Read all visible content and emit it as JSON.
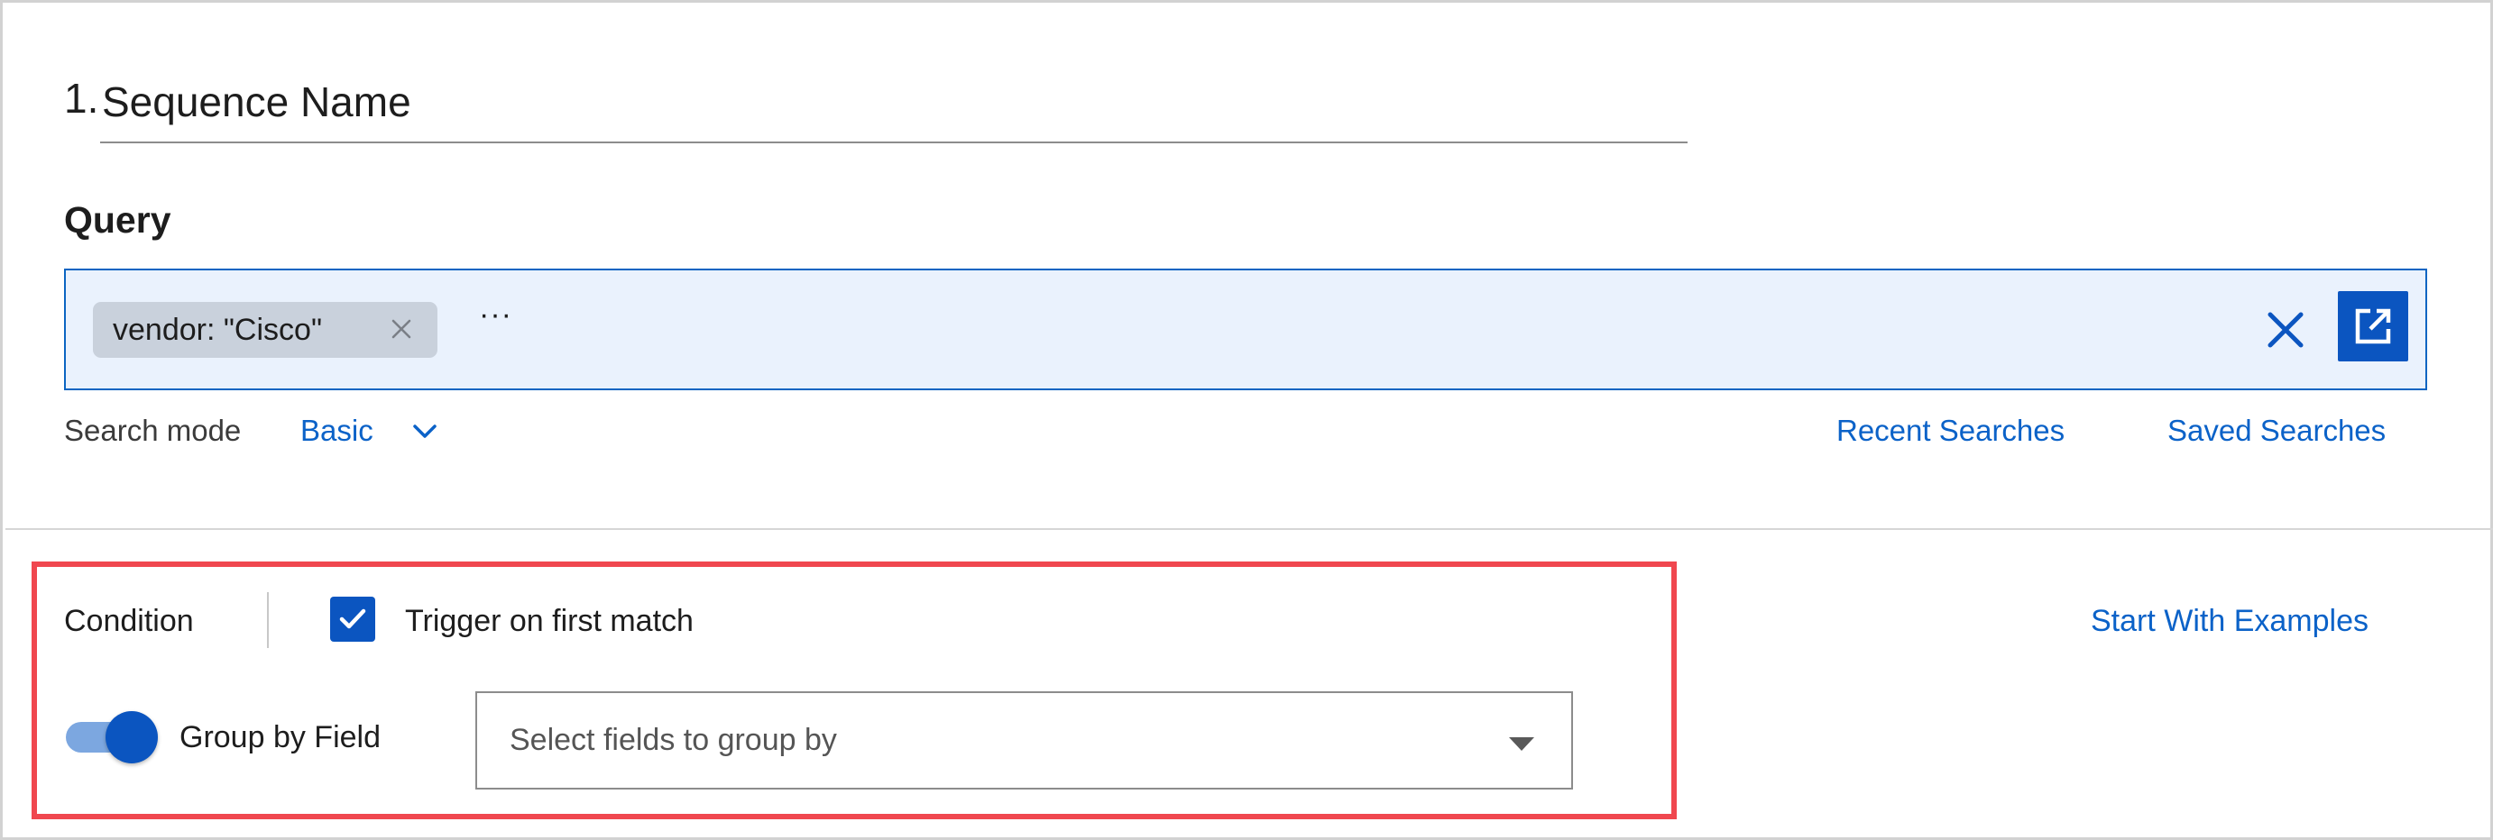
{
  "sequence": {
    "number": "1.",
    "name": "Sequence Name"
  },
  "query": {
    "label": "Query",
    "chip": {
      "text": "vendor: \"Cisco\""
    },
    "ellipsis": "···",
    "search_mode": {
      "label": "Search mode",
      "value": "Basic"
    },
    "links": {
      "recent": "Recent Searches",
      "saved": "Saved Searches"
    },
    "icons": {
      "chip_close": "close-icon",
      "clear": "close-icon",
      "expand": "open-external-icon",
      "mode": "chevron-down-icon"
    }
  },
  "condition": {
    "label": "Condition",
    "trigger": {
      "label": "Trigger on first match",
      "checked": true
    },
    "start_link": "Start With Examples",
    "group_by": {
      "label": "Group by Field",
      "enabled": true,
      "placeholder": "Select fields to group by"
    }
  },
  "colors": {
    "accent": "#0b55c0",
    "link": "#0b62c8",
    "query_bg": "#eaf2fd",
    "highlight": "#f0474f",
    "chip_bg": "#c9d1dc"
  }
}
